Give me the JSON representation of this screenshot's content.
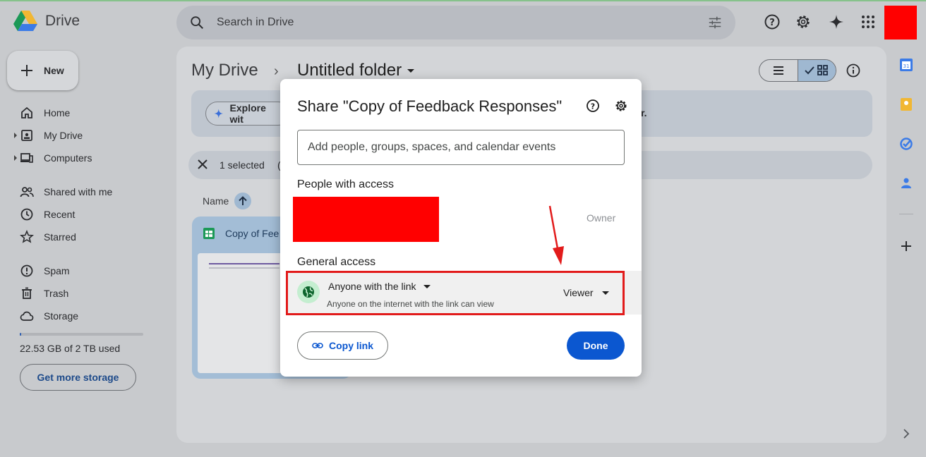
{
  "app": {
    "name": "Drive"
  },
  "search": {
    "placeholder": "Search in Drive"
  },
  "sidebar": {
    "new_label": "New",
    "items": [
      {
        "label": "Home",
        "icon": "home-icon"
      },
      {
        "label": "My Drive",
        "icon": "my-drive-icon"
      },
      {
        "label": "Computers",
        "icon": "computers-icon"
      },
      {
        "label": "Shared with me",
        "icon": "shared-icon"
      },
      {
        "label": "Recent",
        "icon": "clock-icon"
      },
      {
        "label": "Starred",
        "icon": "star-icon"
      },
      {
        "label": "Spam",
        "icon": "spam-icon"
      },
      {
        "label": "Trash",
        "icon": "trash-icon"
      },
      {
        "label": "Storage",
        "icon": "cloud-icon"
      }
    ],
    "storage_used": "22.53 GB of 2 TB used",
    "storage_fraction": 0.011,
    "get_storage_label": "Get more storage"
  },
  "main": {
    "breadcrumb_root": "My Drive",
    "breadcrumb_sep": "›",
    "breadcrumb_current": "Untitled folder",
    "explore_chip": "Explore wit",
    "banner_tail": "r.",
    "selected_text": "1 selected",
    "selected_paren": "(",
    "name_header": "Name",
    "file_name": "Copy of Fee"
  },
  "dialog": {
    "title": "Share \"Copy of Feedback Responses\"",
    "add_placeholder": "Add people, groups, spaces, and calendar events",
    "people_title": "People with access",
    "owner_label": "Owner",
    "general_title": "General access",
    "access_label": "Anyone with the link",
    "access_sub": "Anyone on the internet with the link can view",
    "role_label": "Viewer",
    "copy_link_label": "Copy link",
    "done_label": "Done"
  },
  "colors": {
    "accent": "#0b57d0",
    "highlight": "#e21b1b",
    "redaction": "#ff0000"
  }
}
